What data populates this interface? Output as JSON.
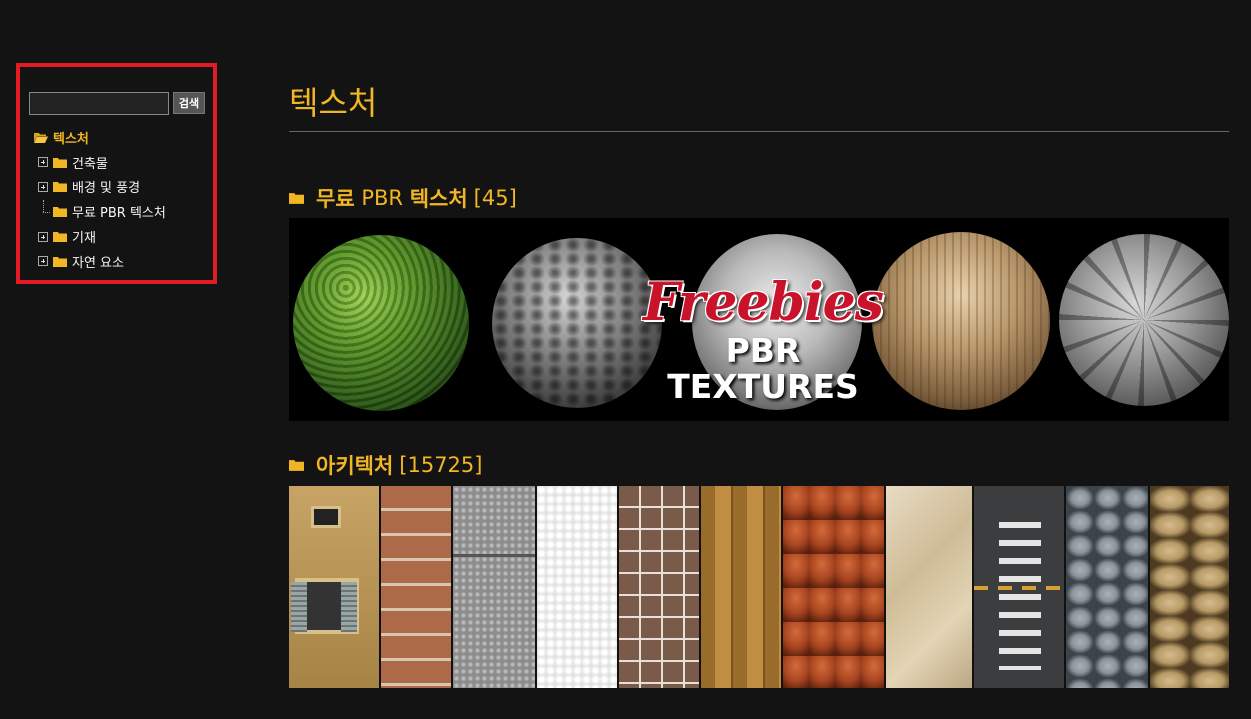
{
  "sidebar": {
    "search_button_label": "검색",
    "tree_root": {
      "label": "텍스처",
      "icon": "folder-open-icon"
    },
    "tree_items": [
      {
        "label": "건축물",
        "expandable": true
      },
      {
        "label": "배경 및 풍경",
        "expandable": true
      },
      {
        "label": "무료 PBR 텍스처",
        "expandable": false
      },
      {
        "label": "기재",
        "expandable": true
      },
      {
        "label": "자연 요소",
        "expandable": true
      }
    ]
  },
  "main": {
    "page_title": "텍스처",
    "sections": [
      {
        "title_prefix": "무료",
        "title_middle": "PBR",
        "title_suffix": "텍스처",
        "count": "[45]",
        "banner": {
          "logo_top": "Freebies",
          "logo_bottom": "PBR TEXTURES"
        }
      },
      {
        "title": "아키텍처",
        "count": "[15725]"
      }
    ]
  },
  "colors": {
    "background": "#131313",
    "accent": "#f1b624",
    "highlight_border": "#e21b24",
    "folder": "#f1b624"
  }
}
